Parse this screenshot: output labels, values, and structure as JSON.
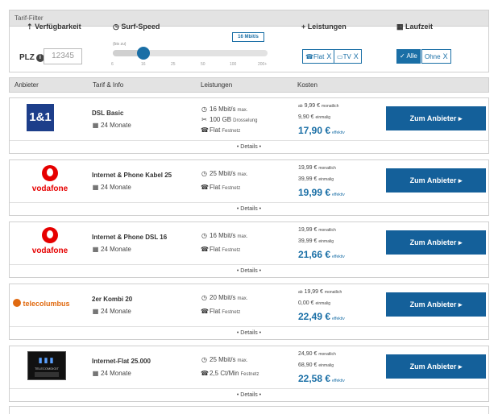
{
  "filter": {
    "title": "Tarif-Filter",
    "availability": {
      "label": "Verfügbarkeit",
      "plz_label": "PLZ",
      "plz_value": "12345"
    },
    "speed": {
      "label": "Surf-Speed",
      "sub": "(bis zu)",
      "badge": "16 Mbit/s",
      "ticks": [
        "6",
        "16",
        "25",
        "50",
        "100",
        "200+"
      ],
      "fill_fraction": 0.22
    },
    "services": {
      "label": "Leistungen",
      "chips": [
        {
          "label": "Flat",
          "close": "X"
        },
        {
          "label": "TV",
          "close": "X"
        }
      ]
    },
    "duration": {
      "label": "Laufzeit",
      "chips": [
        {
          "label": "Alle",
          "check": "✓"
        },
        {
          "label": "Ohne",
          "close": "X"
        }
      ]
    }
  },
  "table": {
    "headers": [
      "Anbieter",
      "Tarif & Info",
      "Leistungen",
      "Kosten"
    ]
  },
  "offers": [
    {
      "provider": "1&1",
      "tariff": "DSL Basic",
      "duration": "24 Monate",
      "features": [
        {
          "icon": "gauge-icon",
          "glyph": "◷",
          "text": "16 Mbit/s",
          "note": "max."
        },
        {
          "icon": "scissors-icon",
          "glyph": "✂",
          "text": "100 GB",
          "note": "Drosselung"
        },
        {
          "icon": "phone-icon",
          "glyph": "☎",
          "text": "Flat",
          "note": "Festnetz"
        }
      ],
      "price_lines": [
        {
          "prefix": "ab",
          "amount": "9,99 €",
          "note": "monatlich"
        },
        {
          "prefix": "",
          "amount": "9,90 €",
          "note": "einmalig"
        }
      ],
      "effective": "17,90 €",
      "effective_note": "effektiv",
      "cta": "Zum Anbieter ▸",
      "details": "• Details •"
    },
    {
      "provider": "vodafone",
      "tariff": "Internet & Phone Kabel 25",
      "duration": "24 Monate",
      "features": [
        {
          "icon": "gauge-icon",
          "glyph": "◷",
          "text": "25 Mbit/s",
          "note": "max."
        },
        {
          "icon": "phone-icon",
          "glyph": "☎",
          "text": "Flat",
          "note": "Festnetz"
        }
      ],
      "price_lines": [
        {
          "prefix": "",
          "amount": "19,99 €",
          "note": "monatlich"
        },
        {
          "prefix": "",
          "amount": "39,99 €",
          "note": "einmalig"
        }
      ],
      "effective": "19,99 €",
      "effective_note": "effektiv",
      "cta": "Zum Anbieter ▸",
      "details": "• Details •"
    },
    {
      "provider": "vodafone",
      "tariff": "Internet & Phone DSL 16",
      "duration": "24 Monate",
      "features": [
        {
          "icon": "gauge-icon",
          "glyph": "◷",
          "text": "16 Mbit/s",
          "note": "max."
        },
        {
          "icon": "phone-icon",
          "glyph": "☎",
          "text": "Flat",
          "note": "Festnetz"
        }
      ],
      "price_lines": [
        {
          "prefix": "",
          "amount": "19,99 €",
          "note": "monatlich"
        },
        {
          "prefix": "",
          "amount": "39,99 €",
          "note": "einmalig"
        }
      ],
      "effective": "21,66 €",
      "effective_note": "effektiv",
      "cta": "Zum Anbieter ▸",
      "details": "• Details •"
    },
    {
      "provider": "telecolumbus",
      "tariff": "2er Kombi 20",
      "duration": "24 Monate",
      "features": [
        {
          "icon": "gauge-icon",
          "glyph": "◷",
          "text": "20 Mbit/s",
          "note": "max."
        },
        {
          "icon": "phone-icon",
          "glyph": "☎",
          "text": "Flat",
          "note": "Festnetz"
        }
      ],
      "price_lines": [
        {
          "prefix": "ab",
          "amount": "19,99 €",
          "note": "monatlich"
        },
        {
          "prefix": "",
          "amount": "0,00 €",
          "note": "einmalig"
        }
      ],
      "effective": "22,49 €",
      "effective_note": "effektiv",
      "cta": "Zum Anbieter ▸",
      "details": "• Details •"
    },
    {
      "provider": "TELECOMDIGIT",
      "tariff": "Internet-Flat 25.000",
      "duration": "24 Monate",
      "features": [
        {
          "icon": "gauge-icon",
          "glyph": "◷",
          "text": "25 Mbit/s",
          "note": "max."
        },
        {
          "icon": "phone-icon",
          "glyph": "☎",
          "text": "2,5 Ct/Min",
          "note": "Festnetz"
        }
      ],
      "price_lines": [
        {
          "prefix": "",
          "amount": "24,90 €",
          "note": "monatlich"
        },
        {
          "prefix": "",
          "amount": "68,90 €",
          "note": "einmalig"
        }
      ],
      "effective": "22,58 €",
      "effective_note": "effektiv",
      "cta": "Zum Anbieter ▸",
      "details": "• Details •"
    }
  ],
  "colors": {
    "accent": "#14609a",
    "vodafone_red": "#e60000",
    "oneandone_blue": "#1d3e8a",
    "telecolumbus_orange": "#e06a10"
  }
}
